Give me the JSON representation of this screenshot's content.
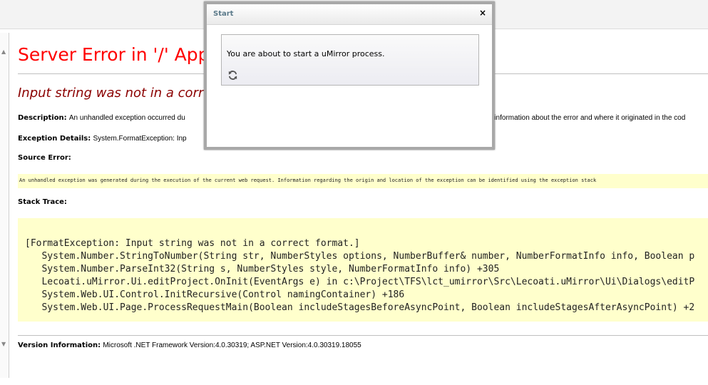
{
  "page": {
    "title": "Server Error in '/' Application.",
    "subtitle": "Input string was not in a correct format.",
    "description_label": "Description:",
    "description_text": "An unhandled exception occurred during the execution of the current web request. Please review the stack trace for more information about the error and where it originated in the code.",
    "description_visible_left": "An unhandled exception occurred du",
    "description_visible_right": "e information about the error and where it originated in the cod",
    "exception_label": "Exception Details:",
    "exception_text": "System.FormatException: Inp",
    "source_error_label": "Source Error:",
    "source_error_text": "An unhandled exception was generated during the execution of the current web request. Information regarding the origin and location of the exception can be identified using the exception stack",
    "stack_trace_label": "Stack Trace:",
    "stack_trace_lines": [
      "[FormatException: Input string was not in a correct format.]",
      "   System.Number.StringToNumber(String str, NumberStyles options, NumberBuffer& number, NumberFormatInfo info, Boolean p",
      "   System.Number.ParseInt32(String s, NumberStyles style, NumberFormatInfo info) +305",
      "   Lecoati.uMirror.Ui.editProject.OnInit(EventArgs e) in c:\\Project\\TFS\\lct_umirror\\Src\\Lecoati.uMirror\\Ui\\Dialogs\\editP",
      "   System.Web.UI.Control.InitRecursive(Control namingContainer) +186",
      "   System.Web.UI.Page.ProcessRequestMain(Boolean includeStagesBeforeAsyncPoint, Boolean includeStagesAfterAsyncPoint) +2"
    ],
    "version_label": "Version Information:",
    "version_text": "Microsoft .NET Framework Version:4.0.30319; ASP.NET Version:4.0.30319.18055"
  },
  "modal": {
    "title": "Start",
    "close_label": "×",
    "message": "You are about to start a uMirror process.",
    "icon": "refresh-icon"
  },
  "colors": {
    "error_title": "#ff0000",
    "error_subtitle": "#8b0000",
    "code_background": "#ffffcc",
    "modal_title": "#5b7a8a"
  }
}
